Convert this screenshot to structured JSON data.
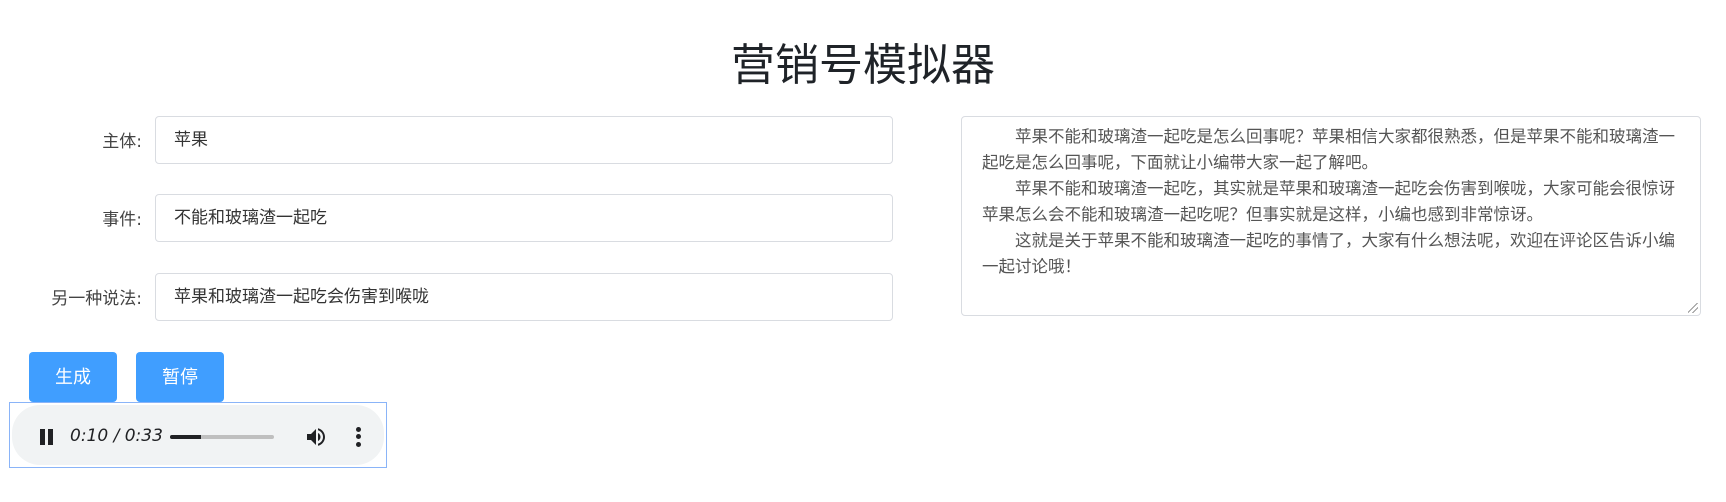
{
  "page": {
    "title": "营销号模拟器"
  },
  "form": {
    "subject_label": "主体:",
    "subject_value": "苹果",
    "event_label": "事件:",
    "event_value": "不能和玻璃渣一起吃",
    "alt_label": "另一种说法:",
    "alt_value": "苹果和玻璃渣一起吃会伤害到喉咙"
  },
  "output": {
    "paragraphs": [
      "苹果不能和玻璃渣一起吃是怎么回事呢？苹果相信大家都很熟悉，但是苹果不能和玻璃渣一起吃是怎么回事呢，下面就让小编带大家一起了解吧。",
      "苹果不能和玻璃渣一起吃，其实就是苹果和玻璃渣一起吃会伤害到喉咙，大家可能会很惊讶苹果怎么会不能和玻璃渣一起吃呢？但事实就是这样，小编也感到非常惊讶。",
      "这就是关于苹果不能和玻璃渣一起吃的事情了，大家有什么想法呢，欢迎在评论区告诉小编一起讨论哦！"
    ]
  },
  "buttons": {
    "generate": "生成",
    "pause": "暂停"
  },
  "audio": {
    "time": "0:10 / 0:33",
    "progress": 0.3,
    "play_state_icon": "pause-icon",
    "volume_icon": "volume-icon",
    "menu_icon": "more-vert-icon"
  },
  "colors": {
    "primary_button": "#409eff",
    "input_border": "#d9dce1"
  }
}
